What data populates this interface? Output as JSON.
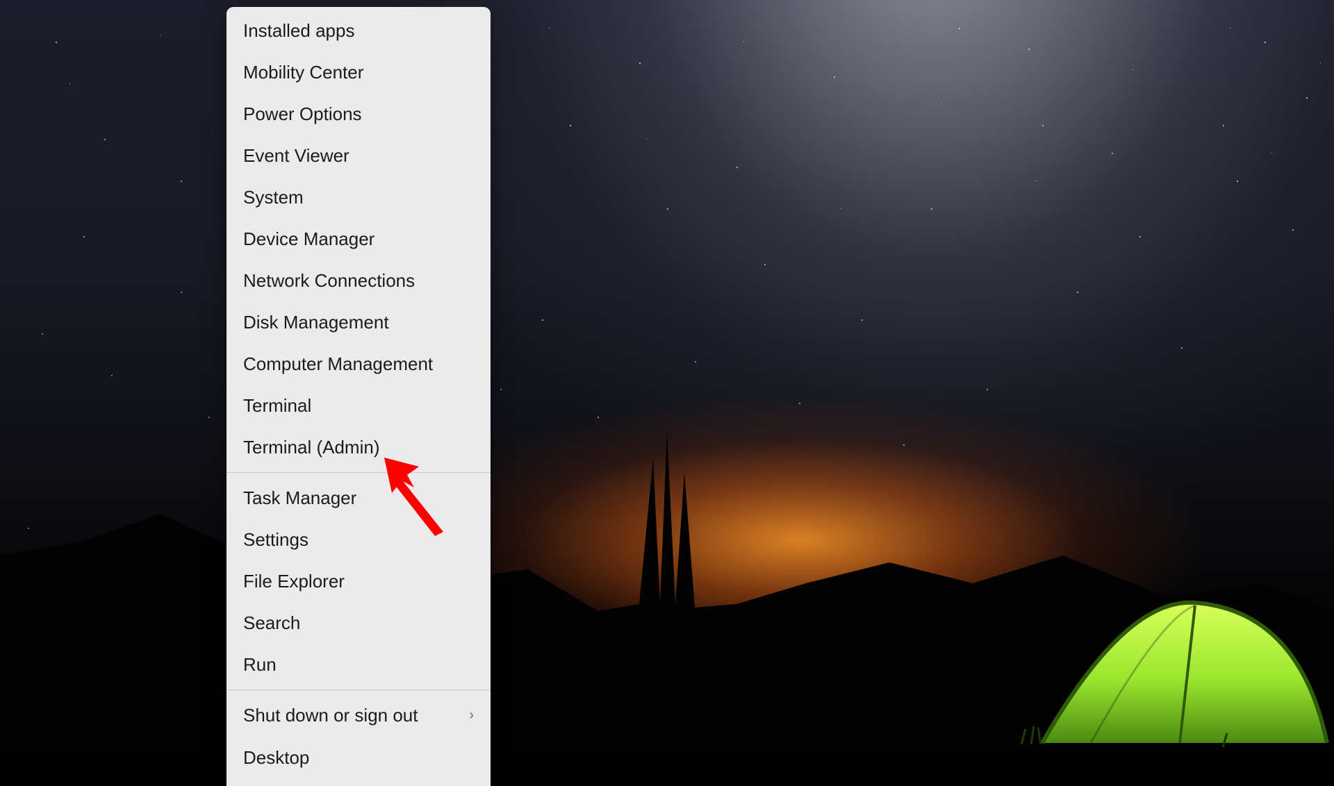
{
  "annotation": {
    "target_label": "Terminal (Admin)",
    "color": "#ff0000"
  },
  "context_menu": {
    "sections": [
      {
        "items": [
          {
            "id": "installed-apps",
            "label": "Installed apps",
            "submenu": false
          },
          {
            "id": "mobility-center",
            "label": "Mobility Center",
            "submenu": false
          },
          {
            "id": "power-options",
            "label": "Power Options",
            "submenu": false
          },
          {
            "id": "event-viewer",
            "label": "Event Viewer",
            "submenu": false
          },
          {
            "id": "system",
            "label": "System",
            "submenu": false
          },
          {
            "id": "device-manager",
            "label": "Device Manager",
            "submenu": false
          },
          {
            "id": "network-connections",
            "label": "Network Connections",
            "submenu": false
          },
          {
            "id": "disk-management",
            "label": "Disk Management",
            "submenu": false
          },
          {
            "id": "computer-management",
            "label": "Computer Management",
            "submenu": false
          },
          {
            "id": "terminal",
            "label": "Terminal",
            "submenu": false
          },
          {
            "id": "terminal-admin",
            "label": "Terminal (Admin)",
            "submenu": false
          }
        ]
      },
      {
        "items": [
          {
            "id": "task-manager",
            "label": "Task Manager",
            "submenu": false
          },
          {
            "id": "settings",
            "label": "Settings",
            "submenu": false
          },
          {
            "id": "file-explorer",
            "label": "File Explorer",
            "submenu": false
          },
          {
            "id": "search",
            "label": "Search",
            "submenu": false
          },
          {
            "id": "run",
            "label": "Run",
            "submenu": false
          }
        ]
      },
      {
        "items": [
          {
            "id": "shut-down-sign-out",
            "label": "Shut down or sign out",
            "submenu": true
          },
          {
            "id": "desktop",
            "label": "Desktop",
            "submenu": false,
            "partial": true
          }
        ]
      }
    ]
  }
}
